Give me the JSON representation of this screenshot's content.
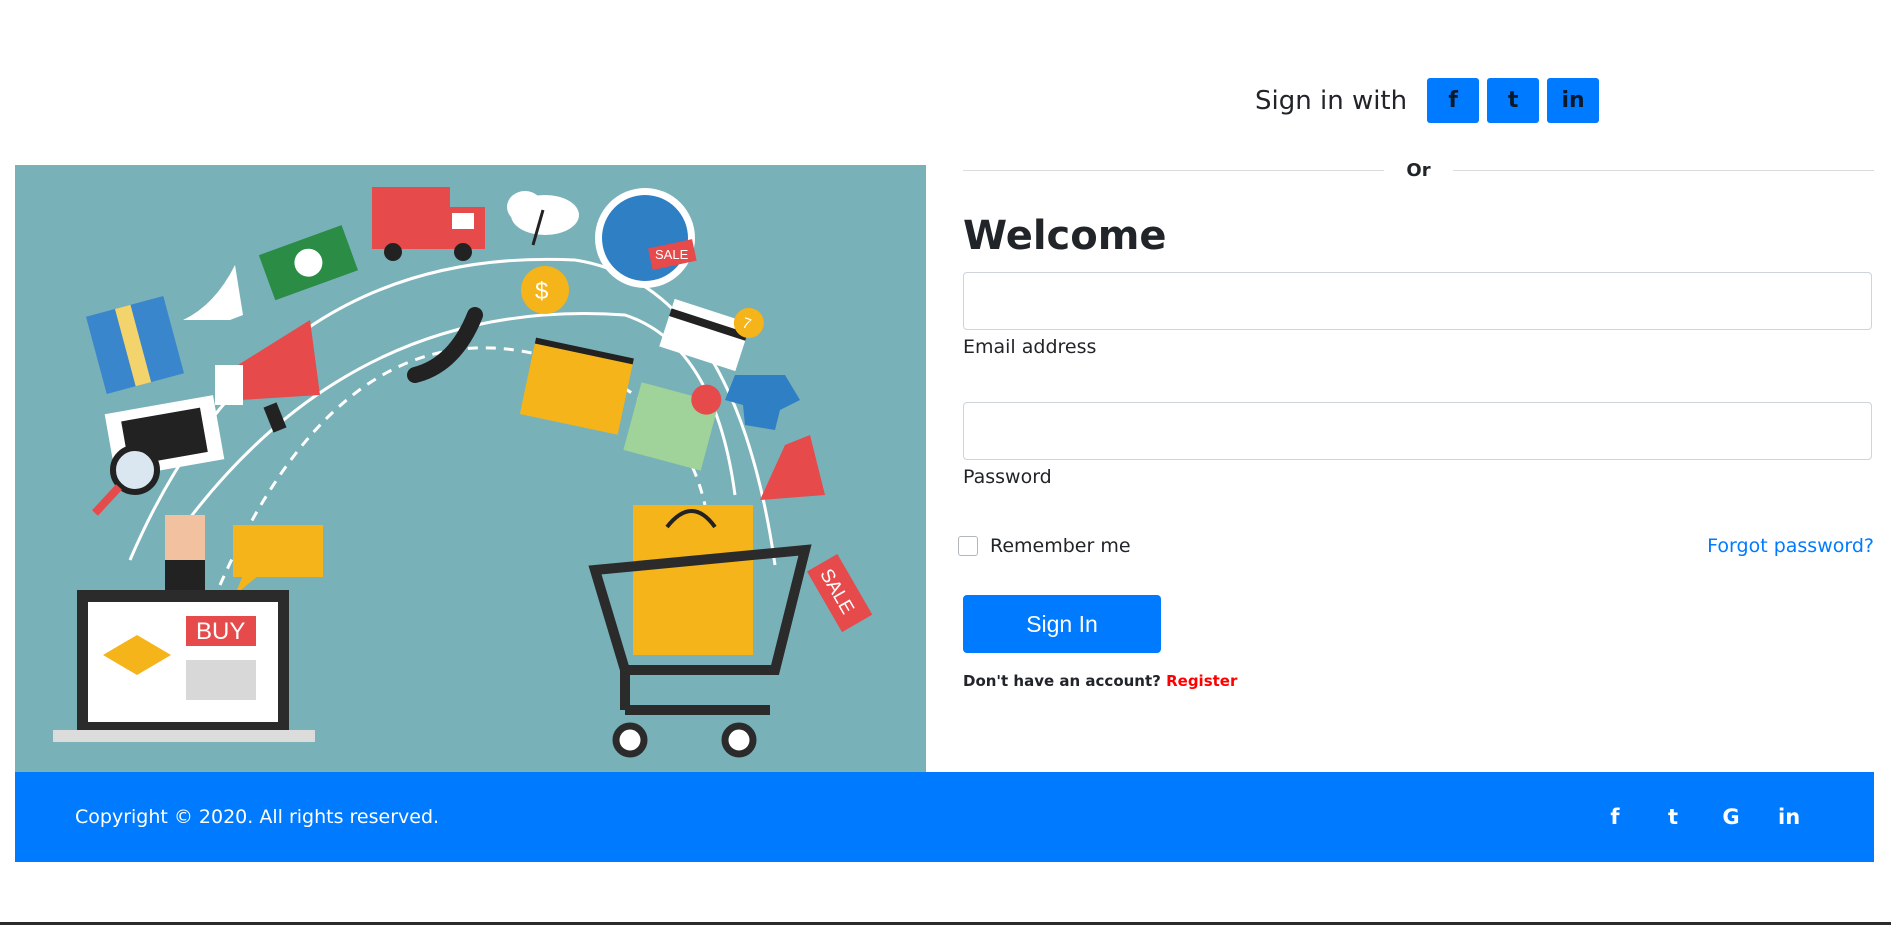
{
  "social_signin": {
    "lead_text": "Sign in with",
    "buttons": [
      {
        "icon": "facebook-icon",
        "glyph": "f"
      },
      {
        "icon": "twitter-icon",
        "glyph": "t"
      },
      {
        "icon": "linkedin-icon",
        "glyph": "in"
      }
    ]
  },
  "divider": {
    "text": "Or"
  },
  "form": {
    "title": "Welcome",
    "email": {
      "label": "Email address",
      "value": "",
      "placeholder": ""
    },
    "password": {
      "label": "Password",
      "value": "",
      "placeholder": ""
    },
    "remember_label": "Remember me",
    "remember_checked": false,
    "forgot_label": "Forgot password?",
    "submit_label": "Sign In",
    "register_prompt": "Don't have an account?",
    "register_link": "Register"
  },
  "hero_image": {
    "texts": {
      "buy": "BUY",
      "sale": "SALE",
      "coin": "$",
      "badge": "7"
    }
  },
  "footer": {
    "copyright": "Copyright © 2020. All rights reserved.",
    "icons": [
      {
        "icon": "facebook-icon",
        "glyph": "f"
      },
      {
        "icon": "twitter-icon",
        "glyph": "t"
      },
      {
        "icon": "google-icon",
        "glyph": "G"
      },
      {
        "icon": "linkedin-icon",
        "glyph": "in"
      }
    ]
  },
  "colors": {
    "primary": "#007bff",
    "hero_bg": "#78b1b8",
    "register": "#ff0000"
  }
}
